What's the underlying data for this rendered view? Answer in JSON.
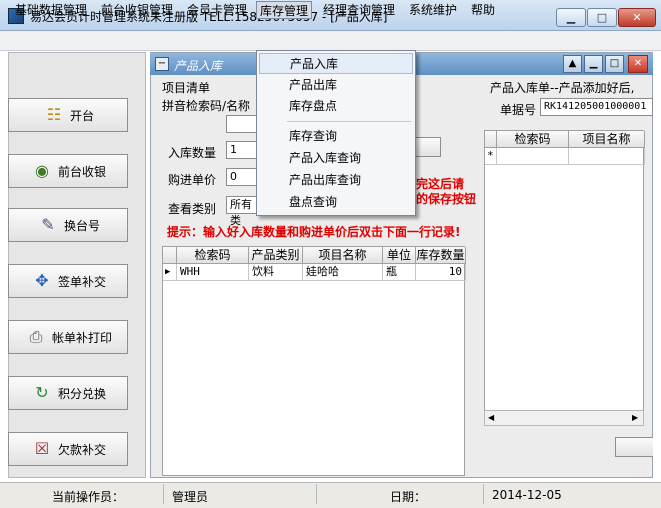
{
  "window": {
    "title": "易达会员计时管理系统未注册版 TELL:15825675057 - [产品入库]",
    "min_icon": "minimize-icon",
    "max_icon": "maximize-icon",
    "close_icon": "close-icon"
  },
  "menu": [
    "基础数据管理",
    "前台收银管理",
    "会员卡管理",
    "库存管理",
    "经理查询管理",
    "系统维护",
    "帮助"
  ],
  "dropdown": [
    "产品入库",
    "产品出库",
    "库存盘点",
    "库存查询",
    "产品入库查询",
    "产品出库查询",
    "盘点查询"
  ],
  "sidebar": [
    "开台",
    "前台收银",
    "换台号",
    "签单补交",
    "帐单补打印",
    "积分兑换",
    "欠款补交"
  ],
  "inner_window": {
    "title": "产品入库"
  },
  "form": {
    "section_title": "项目清单",
    "pinyin_label": "拼音检索码/名称",
    "pinyin_value": "",
    "qty_label": "入库数量",
    "qty_value": "1",
    "price_label": "购进单价",
    "price_value": "0",
    "category_label": "查看类别",
    "category_value": "所有类",
    "save_hint_line1": "完这后请",
    "save_hint_line2": "的保存按钮",
    "tip": "提示：输入好入库数量和购进单价后双击下面一行记录!"
  },
  "product_grid": {
    "headers": [
      "检索码",
      "产品类别",
      "项目名称",
      "单位",
      "库存数量"
    ],
    "rows": [
      [
        "WHH",
        "饮料",
        "娃哈哈",
        "瓶",
        "10"
      ]
    ]
  },
  "right_panel": {
    "title": "产品入库单--产品添加好后,",
    "bill_label": "单据号",
    "bill_no": "RK141205001000001",
    "headers": [
      "检索码",
      "项目名称"
    ],
    "new_row_marker": "*"
  },
  "status": {
    "operator_label": "当前操作员：",
    "operator": "管理员",
    "date_label": "日期：",
    "date": "2014-12-05"
  }
}
